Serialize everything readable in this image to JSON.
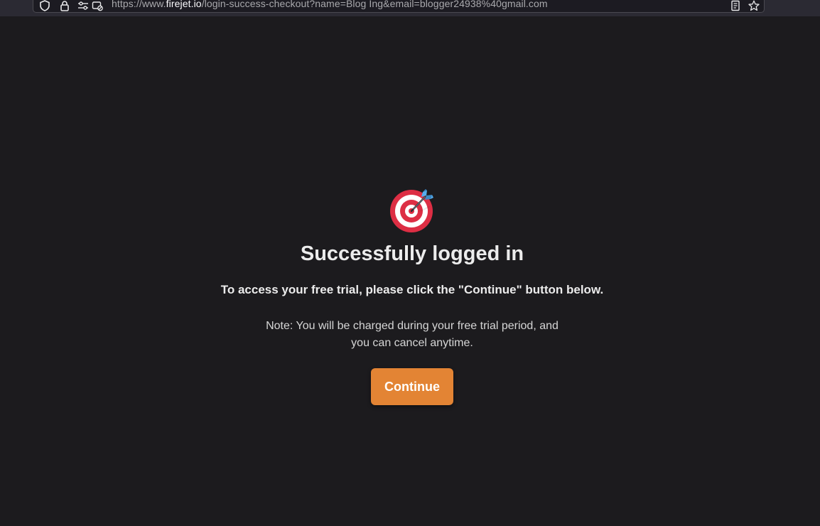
{
  "browser": {
    "url_prefix": "https://www.",
    "url_domain": "firejet.io",
    "url_path": "/login-success-checkout?name=Blog Ing&email=blogger24938%40gmail.com"
  },
  "main": {
    "icon": "direct-hit-target-icon",
    "title": "Successfully logged in",
    "subtitle": "To access your free trial, please click the \"Continue\" button below.",
    "note_line1": "Note: You will be charged during your free trial period, and",
    "note_line2": "you can cancel anytime.",
    "continue_label": "Continue"
  },
  "colors": {
    "background": "#1c1b1e",
    "accent": "#e38434",
    "target_red": "#dd2e44"
  }
}
